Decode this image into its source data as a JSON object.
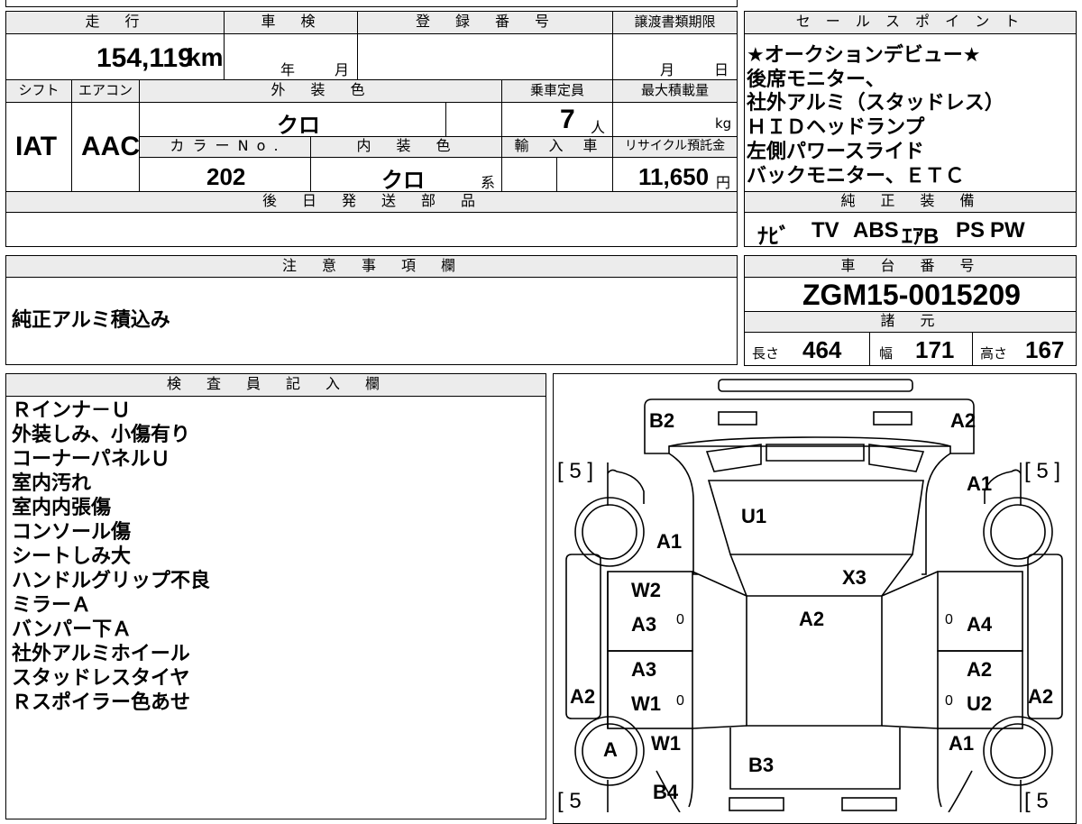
{
  "top": {
    "mileage_label": "走　行",
    "mileage_value": "154,119",
    "mileage_unit": "km",
    "shaken_label": "車　検",
    "shaken_year_unit": "年",
    "shaken_month_unit": "月",
    "registration_label": "登　録　番　号",
    "transfer_doc_label": "譲渡書類期限",
    "transfer_month_unit": "月",
    "transfer_day_unit": "日"
  },
  "second": {
    "shift_label": "シフト",
    "ac_label": "エアコン",
    "exterior_color_label": "外　装　色",
    "capacity_label": "乗車定員",
    "max_load_label": "最大積載量",
    "shift_value": "IAT",
    "ac_value": "AAC",
    "exterior_color_value": "クロ",
    "capacity_value": "7",
    "capacity_unit": "人",
    "max_load_unit": "kg",
    "color_no_label": "カ ラ ー N o .",
    "interior_color_label": "内　装　色",
    "import_label": "輸　入　車",
    "recycle_label": "リサイクル預託金",
    "color_no_value": "202",
    "interior_color_value": "クロ",
    "interior_color_suffix": "系",
    "recycle_value": "11,650",
    "recycle_unit": "円",
    "later_parts_label": "後　日　発　送　部　品"
  },
  "sales": {
    "label": "セ ー ル ス ポ イ ン ト",
    "lines": [
      "★オークションデビュー★",
      "後席モニター、",
      "社外アルミ（スタッドレス）",
      "ＨＩＤヘッドランプ",
      "左側パワースライド",
      "バックモニター、ＥＴＣ"
    ]
  },
  "equipment": {
    "label": "純　正　装　備",
    "items": [
      "ﾅﾋﾞ",
      "TV",
      "ABS",
      "ｴｱB",
      "PS",
      "PW"
    ]
  },
  "notes": {
    "label": "注　意　事　項　欄",
    "text": "純正アルミ積込み"
  },
  "chassis": {
    "label": "車　台　番　号",
    "value": "ZGM15-0015209"
  },
  "specs": {
    "label": "諸　元",
    "length_label": "長さ",
    "length_value": "464",
    "width_label": "幅",
    "width_value": "171",
    "height_label": "高さ",
    "height_value": "167"
  },
  "inspector": {
    "label": "検　査　員　記　入　欄",
    "lines": [
      "Ｒインナ－Ｕ",
      "外装しみ、小傷有り",
      "コーナーパネルＵ",
      "室内汚れ",
      "室内内張傷",
      "コンソール傷",
      "シートしみ大",
      "ハンドルグリップ不良",
      "ミラーＡ",
      "バンパー下Ａ",
      "社外アルミホイール",
      "スタッドレスタイヤ",
      "Ｒスポイラー色あせ"
    ]
  },
  "diagram": {
    "marks": {
      "b2": "B2",
      "a2_top": "A2",
      "a1_right_top": "A1",
      "u1": "U1",
      "a1_left": "A1",
      "x3": "X3",
      "w2": "W2",
      "a3_upper": "A3",
      "a2_center": "A2",
      "a4": "A4",
      "a3_lower": "A3",
      "a2_right_mid": "A2",
      "a2_left_side": "A2",
      "w1_left": "W1",
      "u2": "U2",
      "a2_right_side": "A2",
      "wheel_a": "A",
      "w1_lower": "W1",
      "b3": "B3",
      "a1_right_low": "A1",
      "b4": "B4"
    },
    "tire_left_top": "[ 5 ]",
    "tire_right_top": "[ 5 ]",
    "tire_left_bottom": "[ 5",
    "tire_right_bottom": "[ 5",
    "zero_marks": [
      "0",
      "0",
      "0",
      "0"
    ]
  }
}
